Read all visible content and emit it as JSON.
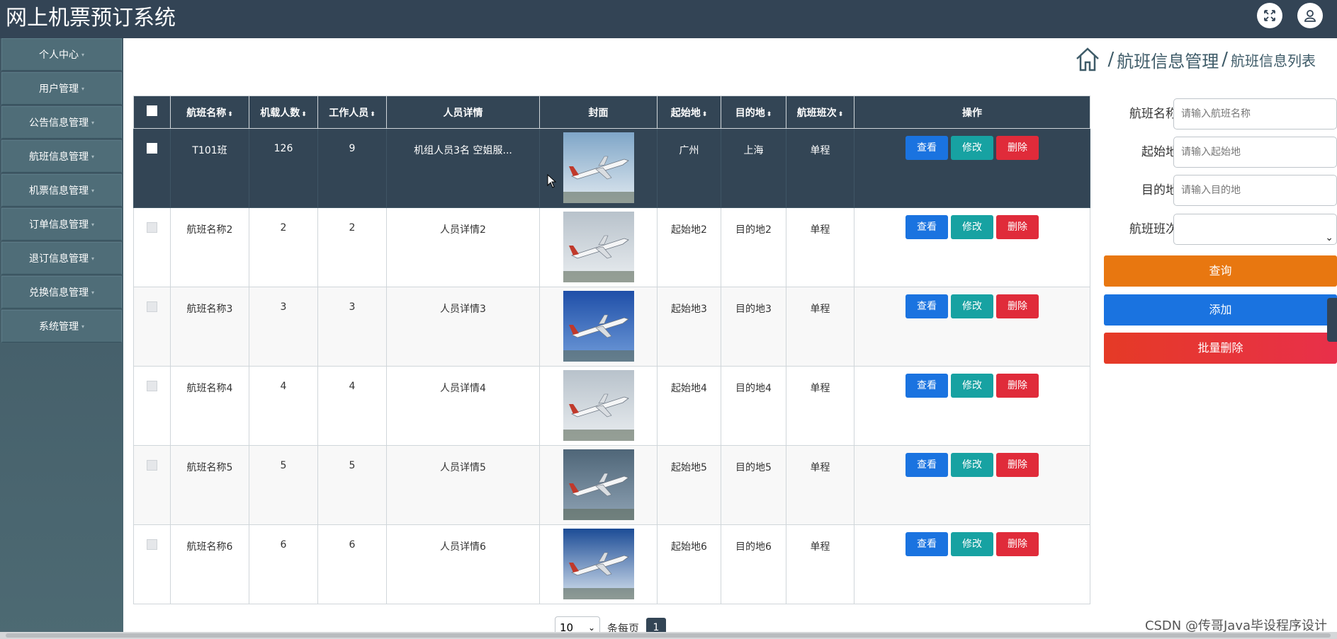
{
  "app": {
    "title": "网上机票预订系统"
  },
  "header": {
    "fullscreen_icon": "expand-icon",
    "user_icon": "user-icon"
  },
  "sidebar": {
    "items": [
      {
        "label": "个人中心"
      },
      {
        "label": "用户管理"
      },
      {
        "label": "公告信息管理"
      },
      {
        "label": "航班信息管理"
      },
      {
        "label": "机票信息管理"
      },
      {
        "label": "订单信息管理"
      },
      {
        "label": "退订信息管理"
      },
      {
        "label": "兑换信息管理"
      },
      {
        "label": "系统管理"
      }
    ],
    "caret": "▾"
  },
  "breadcrumb": {
    "home_icon": "home-icon",
    "separator": "/",
    "section": "航班信息管理",
    "page": "航班信息列表"
  },
  "table": {
    "columns": [
      "航班名称",
      "机载人数",
      "工作人员",
      "人员详情",
      "封面",
      "起始地",
      "目的地",
      "航班班次",
      "操作"
    ],
    "sort_icon": "⬍",
    "actions": {
      "view": "查看",
      "edit": "修改",
      "delete": "删除"
    },
    "rows": [
      {
        "name": "T101班",
        "capacity": "126",
        "staff": "9",
        "detail": "机组人员3名 空姐服...",
        "origin": "广州",
        "destination": "上海",
        "trip": "单程",
        "cover": "plane-image"
      },
      {
        "name": "航班名称2",
        "capacity": "2",
        "staff": "2",
        "detail": "人员详情2",
        "origin": "起始地2",
        "destination": "目的地2",
        "trip": "单程",
        "cover": "plane-image"
      },
      {
        "name": "航班名称3",
        "capacity": "3",
        "staff": "3",
        "detail": "人员详情3",
        "origin": "起始地3",
        "destination": "目的地3",
        "trip": "单程",
        "cover": "plane-image"
      },
      {
        "name": "航班名称4",
        "capacity": "4",
        "staff": "4",
        "detail": "人员详情4",
        "origin": "起始地4",
        "destination": "目的地4",
        "trip": "单程",
        "cover": "plane-image"
      },
      {
        "name": "航班名称5",
        "capacity": "5",
        "staff": "5",
        "detail": "人员详情5",
        "origin": "起始地5",
        "destination": "目的地5",
        "trip": "单程",
        "cover": "plane-image"
      },
      {
        "name": "航班名称6",
        "capacity": "6",
        "staff": "6",
        "detail": "人员详情6",
        "origin": "起始地6",
        "destination": "目的地6",
        "trip": "单程",
        "cover": "plane-image"
      }
    ]
  },
  "search": {
    "name_label": "航班名称",
    "name_placeholder": "请输入航班名称",
    "origin_label": "起始地",
    "origin_placeholder": "请输入起始地",
    "dest_label": "目的地",
    "dest_placeholder": "请输入目的地",
    "trip_label": "航班班次",
    "trip_value": "",
    "query": "查询",
    "add": "添加",
    "batch_delete": "批量删除"
  },
  "pager": {
    "page_size": "10",
    "per_page_label": "条每页",
    "current_page": "1"
  },
  "watermark": "CSDN @传哥Java毕设程序设计",
  "colors": {
    "header": "#334455",
    "view": "#1a73e0",
    "edit": "#17a2a2",
    "delete": "#e02b3a",
    "query": "#e87710"
  }
}
